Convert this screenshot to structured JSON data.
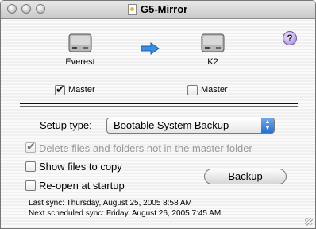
{
  "window": {
    "title": "G5-Mirror"
  },
  "source": {
    "name": "Everest",
    "master_label": "Master",
    "master_checked": true
  },
  "target": {
    "name": "K2",
    "master_label": "Master",
    "master_checked": false
  },
  "help": {
    "label": "?"
  },
  "setup": {
    "label": "Setup type:",
    "value": "Bootable System Backup"
  },
  "options": {
    "delete_label": "Delete files and folders not in the master folder",
    "delete_checked": true,
    "show_files_label": "Show files to copy",
    "show_files_checked": false,
    "reopen_label": "Re-open at startup",
    "reopen_checked": false
  },
  "backup_button": {
    "label": "Backup"
  },
  "status": {
    "last_sync": "Last sync: Thursday, August 25, 2005  8:58 AM",
    "next_sync": "Next scheduled sync: Friday, August 26, 2005  7:45 AM"
  }
}
